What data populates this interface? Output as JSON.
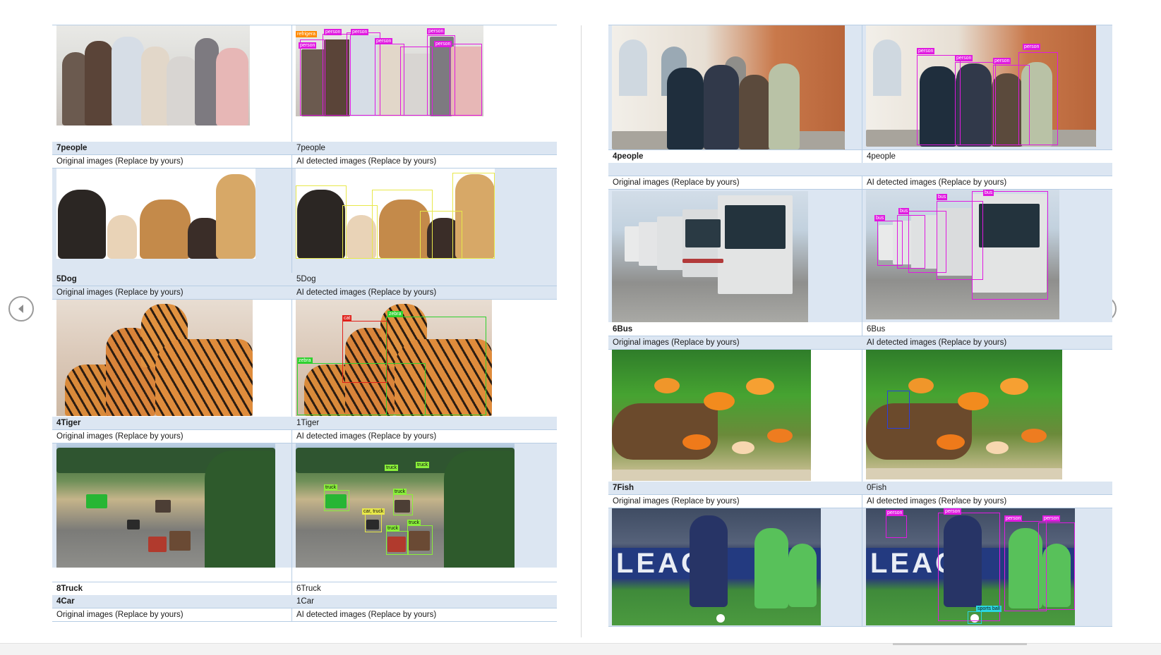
{
  "nav": {
    "prev_icon": "chevron-left-icon",
    "next_icon": "chevron-right-icon"
  },
  "left_page": {
    "rows": [
      {
        "name": "7people",
        "detected": "7people",
        "orig_label": "Original images (Replace by yours)",
        "ai_label": "AI detected images (Replace by yours)"
      },
      {
        "name": "5Dog",
        "detected": "5Dog",
        "orig_label": "Original images (Replace by yours)",
        "ai_label": "AI detected images (Replace by yours)"
      },
      {
        "name": "4Tiger",
        "detected": "1Tiger",
        "orig_label": "Original images (Replace by yours)",
        "ai_label": "AI detected images (Replace by yours)"
      },
      {
        "name": "8Truck",
        "detected": "6Truck",
        "name2": "4Car",
        "detected2": "1Car",
        "orig_label": "Original images (Replace by yours)",
        "ai_label": "AI detected images (Replace by yours)"
      }
    ]
  },
  "right_page": {
    "rows": [
      {
        "name": "4people",
        "detected": "4people",
        "orig_label": "Original images (Replace by yours)",
        "ai_label": "AI detected images (Replace by yours)"
      },
      {
        "name": "6Bus",
        "detected": "6Bus",
        "orig_label": "Original images (Replace by yours)",
        "ai_label": "AI detected images (Replace by yours)"
      },
      {
        "name": "7Fish",
        "detected": "0Fish",
        "orig_label": "Original images (Replace by yours)",
        "ai_label": "AI detected images (Replace by yours)"
      }
    ]
  },
  "detection_tags": {
    "people": [
      "refrigera",
      "person",
      "person",
      "person",
      "person",
      "person",
      "person"
    ],
    "people4": [
      "person",
      "person",
      "person",
      "person"
    ],
    "bus": [
      "bus",
      "bus",
      "bus",
      "bus"
    ],
    "tiger": [
      "zebra",
      "zebra",
      "cat"
    ],
    "truck": [
      "truck",
      "truck",
      "truck",
      "truck",
      "car, truck",
      "truck",
      "truck"
    ],
    "soccer": [
      "person",
      "person",
      "person",
      "person",
      "sports ball"
    ]
  },
  "colors": {
    "table_blue": "#dce6f2",
    "table_line": "#b7cde4",
    "box_magenta": "#e01ae0",
    "box_green": "#2fd12f",
    "box_yellow": "#e8e84a"
  }
}
